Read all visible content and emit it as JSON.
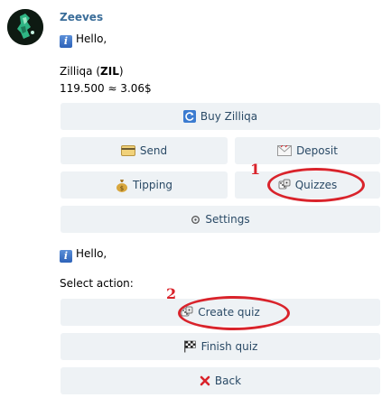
{
  "message1": {
    "sender": "Zeeves",
    "greeting": "Hello,",
    "asset_name": "Zilliqa (",
    "asset_ticker": "ZIL",
    "asset_close": ")",
    "balance": "119.500 ≈ 3.06$"
  },
  "keyboard1": {
    "buy": "Buy Zilliqa",
    "send": "Send",
    "deposit": "Deposit",
    "tipping": "Tipping",
    "quizzes": "Quizzes",
    "settings": "Settings"
  },
  "message2": {
    "greeting": "Hello,",
    "prompt": "Select action:"
  },
  "keyboard2": {
    "create_quiz": "Create quiz",
    "finish_quiz": "Finish quiz",
    "back": "Back"
  },
  "annotations": {
    "marker1": "1",
    "marker2": "2",
    "color": "#d9232b"
  },
  "icons": {
    "info": "i",
    "refresh": "refresh-icon",
    "card": "credit-card-icon",
    "envelope": "envelope-icon",
    "money_bag": "money-bag-icon",
    "dice": "dice-icon",
    "gear": "gear-icon",
    "checkered_flag": "checkered-flag-icon",
    "cross": "cross-icon"
  }
}
